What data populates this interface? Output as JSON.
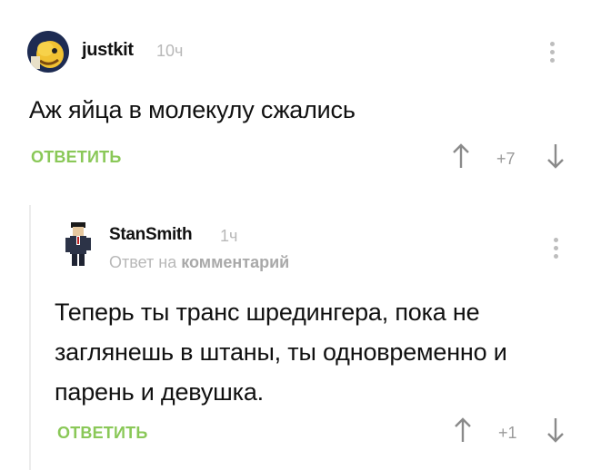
{
  "comment": {
    "author": "justkit",
    "time": "10ч",
    "text": "Аж яйца в молекулу сжались",
    "reply_label": "ОТВЕТИТЬ",
    "score": "+7",
    "avatar_icon": "cartoon-avatar-icon"
  },
  "reply": {
    "author": "StanSmith",
    "time": "1ч",
    "reply_to_prefix": "Ответ на",
    "reply_to_link": "комментарий",
    "text": "Теперь ты транс шредингера, пока не заглянешь в штаны, ты одновременно и парень и девушка.",
    "reply_label": "ОТВЕТИТЬ",
    "score": "+1",
    "avatar_icon": "man-in-suit-avatar-icon"
  },
  "colors": {
    "accent_green": "#8ac858",
    "muted_gray": "#b8b8b8",
    "text": "#111111"
  }
}
